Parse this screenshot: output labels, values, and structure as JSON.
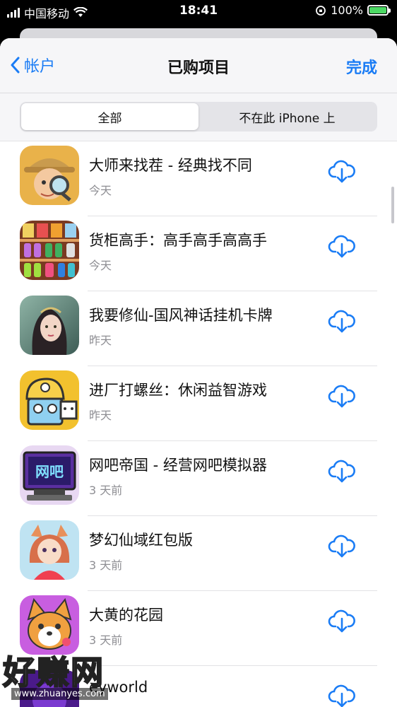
{
  "status_bar": {
    "carrier": "中国移动",
    "time": "18:41",
    "battery": "100%"
  },
  "nav": {
    "back_label": "帐户",
    "title": "已购项目",
    "done_label": "完成"
  },
  "segments": [
    {
      "label": "全部",
      "active": true
    },
    {
      "label": "不在此 iPhone 上",
      "active": false
    }
  ],
  "apps": [
    {
      "name": "大师来找茬 - 经典找不同",
      "date": "今天",
      "icon": "detective-boy-icon"
    },
    {
      "name": "货柜高手：高手高手高高手",
      "date": "今天",
      "icon": "shelf-goods-icon"
    },
    {
      "name": "我要修仙-国风神话挂机卡牌",
      "date": "昨天",
      "icon": "fairy-lady-icon"
    },
    {
      "name": "进厂打螺丝：休闲益智游戏",
      "date": "昨天",
      "icon": "worker-robot-icon"
    },
    {
      "name": "网吧帝国 - 经营网吧模拟器",
      "date": "3 天前",
      "icon": "internet-cafe-monitor-icon"
    },
    {
      "name": "梦幻仙域红包版",
      "date": "3 天前",
      "icon": "fox-girl-icon"
    },
    {
      "name": "大黄的花园",
      "date": "3 天前",
      "icon": "corgi-dog-icon"
    },
    {
      "name": "eyworld",
      "date": "",
      "icon": "purple-app-icon"
    }
  ],
  "watermark": {
    "big": "好赚网",
    "small": "www.zhuanyes.com"
  },
  "colors": {
    "accent": "#1a7cf5",
    "secondary_text": "#8e8e93"
  }
}
